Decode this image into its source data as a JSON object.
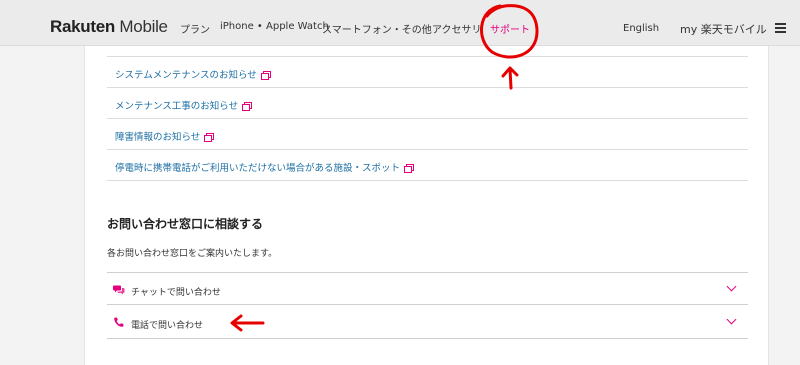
{
  "header": {
    "logo_brand": "Rakuten",
    "logo_sub": "Mobile",
    "nav": [
      {
        "label": "プラン"
      },
      {
        "label": "iPhone • Apple Watch"
      },
      {
        "label": "スマートフォン・その他"
      },
      {
        "label": "アクセサリ"
      },
      {
        "label": "サポート"
      }
    ],
    "english": "English",
    "my_label": "my 楽天モバイル"
  },
  "links": [
    {
      "label": "システムメンテナンスのお知らせ"
    },
    {
      "label": "メンテナンス工事のお知らせ"
    },
    {
      "label": "障害情報のお知らせ"
    },
    {
      "label": "停電時に携帯電話がご利用いただけない場合がある施設・スポット"
    }
  ],
  "contact": {
    "title": "お問い合わせ窓口に相談する",
    "description": "各お問い合わせ窓口をご案内いたします。",
    "items": [
      {
        "label": "チャットで問い合わせ",
        "icon": "chat-icon"
      },
      {
        "label": "電話で問い合わせ",
        "icon": "phone-icon"
      }
    ]
  },
  "colors": {
    "accent": "#e4007f",
    "link": "#1d6fa5",
    "annotation": "#e60000"
  }
}
